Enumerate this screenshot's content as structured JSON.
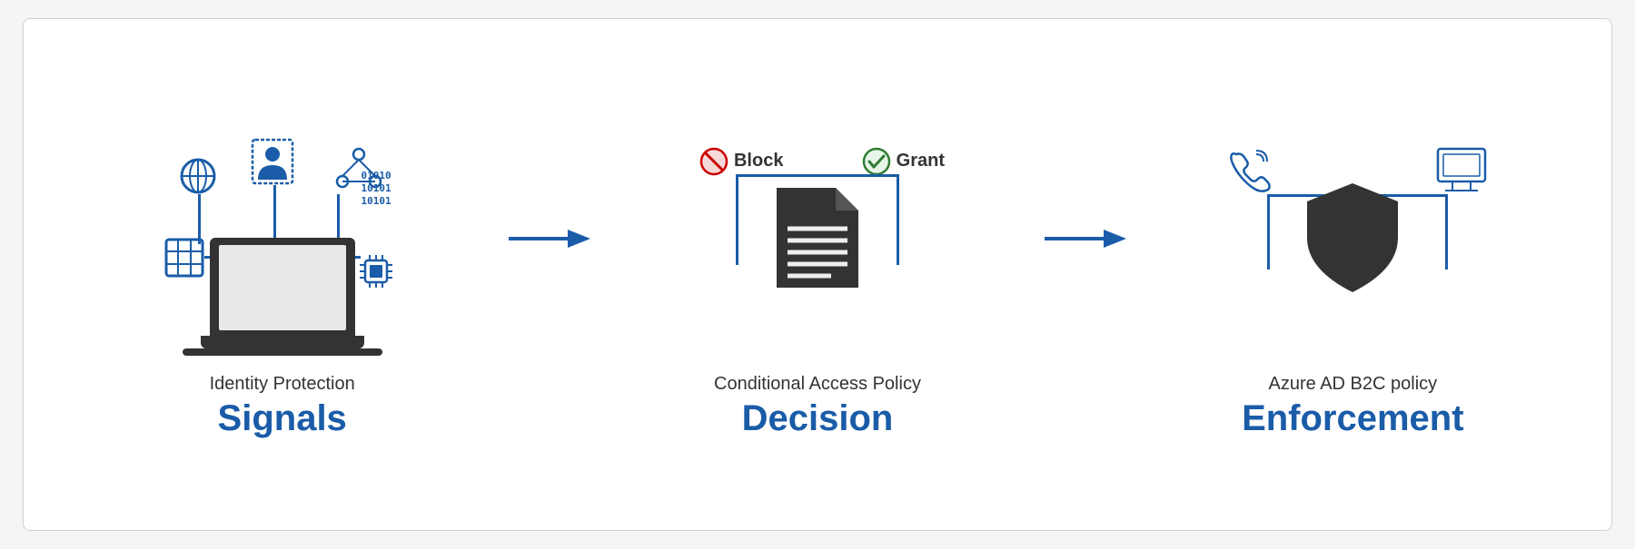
{
  "page": {
    "background": "#f5f5f5",
    "card_background": "#ffffff"
  },
  "section1": {
    "subtitle": "Identity Protection",
    "title": "Signals",
    "icons": {
      "globe": "🌐",
      "user": "👤",
      "network": "⬡",
      "binary": "01010\n10101\n10101",
      "grid": "⊞",
      "chip": "🔲"
    }
  },
  "section2": {
    "subtitle": "Conditional Access Policy",
    "title": "Decision",
    "block_label": "Block",
    "grant_label": "Grant"
  },
  "section3": {
    "subtitle": "Azure AD B2C policy",
    "title": "Enforcement"
  },
  "arrow": "→",
  "colors": {
    "blue": "#1a5ca8",
    "dark": "#333333",
    "red": "#cc0000",
    "green": "#2e7d32"
  }
}
